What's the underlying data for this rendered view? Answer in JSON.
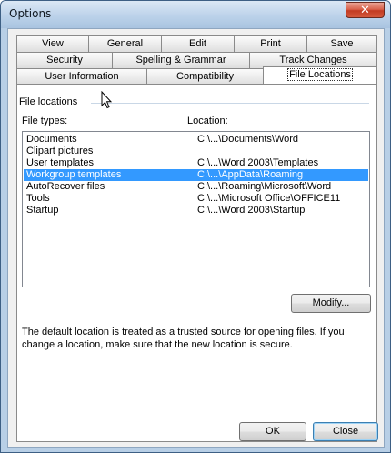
{
  "window": {
    "title": "Options",
    "close_glyph": "✕"
  },
  "tabs": {
    "row1": [
      "View",
      "General",
      "Edit",
      "Print",
      "Save"
    ],
    "row2": [
      "Security",
      "Spelling & Grammar",
      "Track Changes"
    ],
    "row3": [
      "User Information",
      "Compatibility",
      "File Locations"
    ],
    "active": "File Locations"
  },
  "file_locations": {
    "group_label": "File locations",
    "file_types_header": "File types:",
    "location_header": "Location:",
    "rows": [
      {
        "type": "Documents",
        "location": "C:\\...\\Documents\\Word"
      },
      {
        "type": "Clipart pictures",
        "location": ""
      },
      {
        "type": "User templates",
        "location": "C:\\...\\Word 2003\\Templates"
      },
      {
        "type": "Workgroup templates",
        "location": "C:\\...\\AppData\\Roaming"
      },
      {
        "type": "AutoRecover files",
        "location": "C:\\...\\Roaming\\Microsoft\\Word"
      },
      {
        "type": "Tools",
        "location": "C:\\...\\Microsoft Office\\OFFICE11"
      },
      {
        "type": "Startup",
        "location": "C:\\...\\Word 2003\\Startup"
      }
    ],
    "selected_row": "Workgroup templates",
    "modify_label": "Modify...",
    "note": "The default location is treated as a trusted source for opening files. If you change a location, make sure that the new location is secure."
  },
  "footer": {
    "ok_label": "OK",
    "close_label": "Close"
  },
  "icons": {
    "cursor": "mouse-pointer-icon"
  }
}
